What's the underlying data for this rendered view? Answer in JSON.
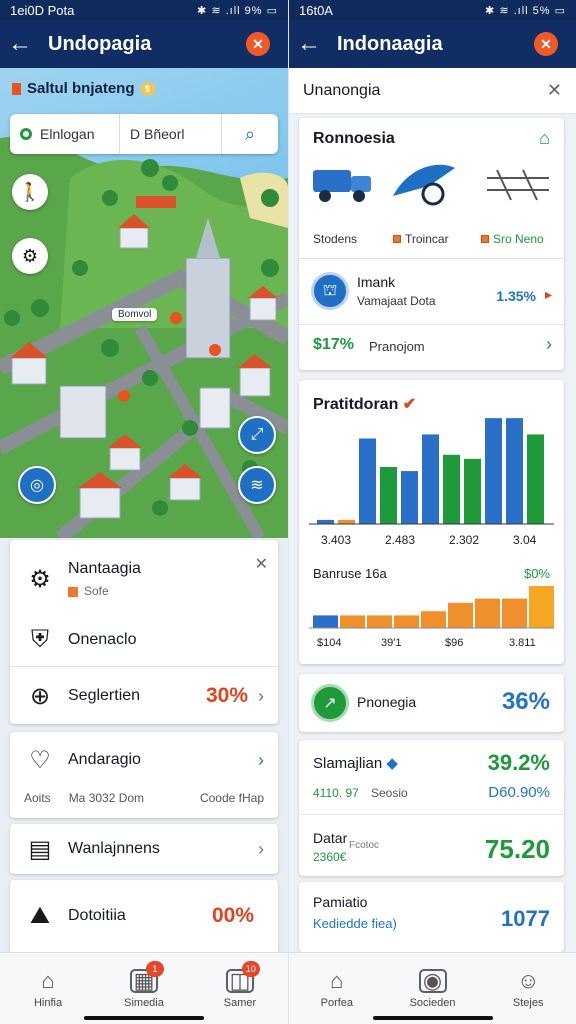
{
  "left": {
    "status": {
      "time": "1ei0D Pota",
      "icons": "✱ ≋ .ıll 9% ▭"
    },
    "appbar": {
      "back": "←",
      "title": "Undopagia",
      "close": "✕"
    },
    "map": {
      "header": "Saltul bnjateng",
      "search": {
        "field1": "Elnlogan",
        "field2": "D Bñeorl",
        "button_icon": "search-icon"
      },
      "pill": "Bomvol"
    },
    "list": {
      "card1": {
        "title": "Nantaagia",
        "subtitle": "Sofe",
        "row2": "Onenaclo"
      },
      "row3": {
        "label": "Seglertien",
        "value": "30%"
      },
      "card4": {
        "label": "Andaragio",
        "sub_a": "Aoits",
        "sub_b": "Ma 3032 Dom",
        "sub_c": "Coode fHap"
      },
      "row5": {
        "label": "Wanlajnnens"
      },
      "row6": {
        "label": "Dotoitiia",
        "value": "00%"
      }
    },
    "nav": [
      {
        "label": "Hinfia",
        "icon": "home-icon",
        "badge": ""
      },
      {
        "label": "Simedia",
        "icon": "media-icon",
        "badge": "1"
      },
      {
        "label": "Samer",
        "icon": "messages-icon",
        "badge": "10"
      }
    ]
  },
  "right": {
    "status": {
      "time": "16t0A",
      "icons": "✱ ≋ .ıll 5% ▭"
    },
    "appbar": {
      "back": "←",
      "title": "Indonaagia",
      "close": "✕"
    },
    "header": "Unanongia",
    "card1": {
      "title": "Ronnoesia",
      "categories": [
        "Stodens",
        "Troincar",
        "Sro Neno"
      ],
      "info_title": "Imank",
      "info_sub": "Vamajaat Dota",
      "info_value": "1.35%",
      "footer_value": "$17%",
      "footer_label": "Pranojom"
    },
    "card2": {
      "title": "Pratitdoran",
      "bar_ticks": [
        "3.403",
        "2.483",
        "2.302",
        "3.04"
      ],
      "line_label": "Banruse 16a",
      "line_value": "$0%",
      "line_ticks": [
        "$104",
        "39'1",
        "$96",
        "3.811"
      ]
    },
    "card3": {
      "label": "Pnonegia",
      "value": "36%"
    },
    "card4": {
      "title": "Slamajlian",
      "row1_left": "4110. 97",
      "row1_mid": "Seosio",
      "row1_right": "39.2%",
      "row1_right2": "D60.90%",
      "row2_title": "Datar",
      "row2_sub": "2360€",
      "row2_note": "Fcotoc",
      "row2_value": "75.20"
    },
    "card5": {
      "title": "Pamiatio",
      "sub": "Kediedde fiea)",
      "value": "1077"
    },
    "nav": [
      {
        "label": "Porfea",
        "icon": "home-icon"
      },
      {
        "label": "Socieden",
        "icon": "camera-icon"
      },
      {
        "label": "Stejes",
        "icon": "profile-icon"
      }
    ]
  },
  "chart_data": [
    {
      "type": "bar",
      "title": "Pratitdoran",
      "categories": [
        "3.403",
        "2.483",
        "2.302",
        "3.04"
      ],
      "series": [
        {
          "values": [
            1,
            1,
            21,
            14,
            13,
            22,
            17,
            16,
            26,
            26,
            22
          ]
        }
      ],
      "colors": [
        "#2a70c8",
        "#f0902d",
        "#1e9a3b"
      ],
      "grid": false
    },
    {
      "type": "bar",
      "title": "Banruse 16a",
      "categories": [
        "$104",
        "39'1",
        "$96",
        "3.811"
      ],
      "series": [
        {
          "values": [
            3,
            3,
            3,
            3,
            4,
            6,
            7,
            7,
            10
          ]
        }
      ],
      "colors": [
        "#2a70c8",
        "#f0902d",
        "#f5a623"
      ],
      "grid": false
    }
  ]
}
